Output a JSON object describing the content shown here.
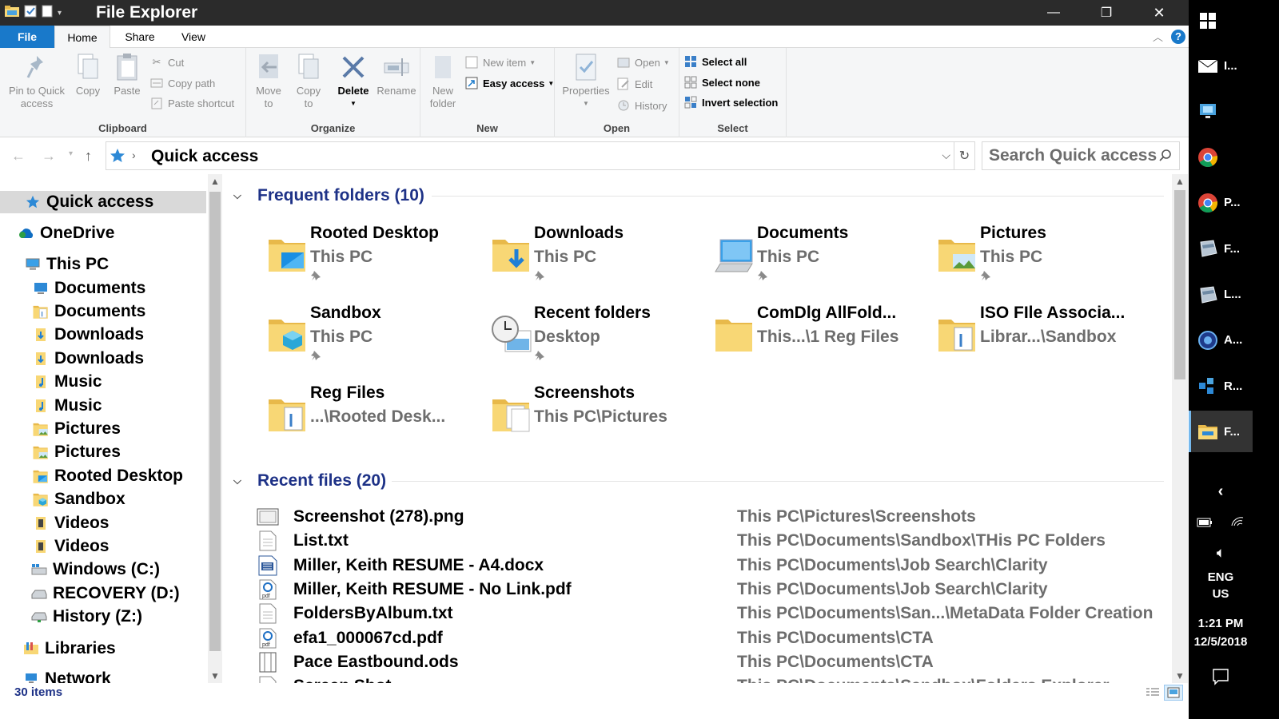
{
  "window": {
    "title": "File Explorer",
    "minimize_glyph": "—",
    "restore_glyph": "❐",
    "close_glyph": "✕"
  },
  "ribbon_tabs": [
    {
      "label": "File"
    },
    {
      "label": "Home"
    },
    {
      "label": "Share"
    },
    {
      "label": "View"
    }
  ],
  "ribbon": {
    "clipboard": {
      "label": "Clipboard",
      "pin_label_1": "Pin to Quick",
      "pin_label_2": "access",
      "copy_label": "Copy",
      "paste_label": "Paste",
      "cut_label": "Cut",
      "copy_path_label": "Copy path",
      "paste_shortcut_label": "Paste shortcut"
    },
    "organize": {
      "label": "Organize",
      "move_to_1": "Move",
      "move_to_2": "to",
      "copy_to_1": "Copy",
      "copy_to_2": "to",
      "delete_label": "Delete",
      "rename_label": "Rename"
    },
    "new": {
      "label": "New",
      "new_folder_1": "New",
      "new_folder_2": "folder",
      "new_item_label": "New item",
      "easy_access_label": "Easy access"
    },
    "open": {
      "label": "Open",
      "properties_label": "Properties",
      "open_label": "Open",
      "edit_label": "Edit",
      "history_label": "History"
    },
    "select": {
      "label": "Select",
      "select_all_label": "Select all",
      "select_none_label": "Select none",
      "invert_label": "Invert selection"
    }
  },
  "address": {
    "location": "Quick access",
    "separator": "›",
    "search_placeholder": "Search Quick access"
  },
  "nav": {
    "items": [
      {
        "label": "Quick access",
        "icon": "star-icon"
      },
      {
        "label": "OneDrive",
        "icon": "cloud-icon"
      },
      {
        "label": "This PC",
        "icon": "computer-icon"
      },
      {
        "label": "Documents",
        "icon": "desktop-icon"
      },
      {
        "label": "Documents",
        "icon": "document-folder-icon"
      },
      {
        "label": "Downloads",
        "icon": "download-folder-icon"
      },
      {
        "label": "Downloads",
        "icon": "download-folder-icon"
      },
      {
        "label": "Music",
        "icon": "music-folder-icon"
      },
      {
        "label": "Music",
        "icon": "music-folder-icon"
      },
      {
        "label": "Pictures",
        "icon": "pictures-folder-icon"
      },
      {
        "label": "Pictures",
        "icon": "pictures-folder-icon"
      },
      {
        "label": "Rooted Desktop",
        "icon": "desktop-folder-icon"
      },
      {
        "label": "Sandbox",
        "icon": "sandbox-folder-icon"
      },
      {
        "label": "Videos",
        "icon": "videos-folder-icon"
      },
      {
        "label": "Videos",
        "icon": "videos-folder-icon"
      },
      {
        "label": "Windows (C:)",
        "icon": "windows-drive-icon"
      },
      {
        "label": "RECOVERY (D:)",
        "icon": "drive-icon"
      },
      {
        "label": "History (Z:)",
        "icon": "network-drive-icon"
      },
      {
        "label": "Libraries",
        "icon": "libraries-icon"
      },
      {
        "label": "Network",
        "icon": "network-icon"
      }
    ]
  },
  "frequent": {
    "header": "Frequent folders (10)",
    "tiles": [
      {
        "name": "Rooted Desktop",
        "path": "This PC",
        "pinned": true,
        "icon": "desktop-folder-icon"
      },
      {
        "name": "Downloads",
        "path": "This PC",
        "pinned": true,
        "icon": "downloads-folder-icon"
      },
      {
        "name": "Documents",
        "path": "This PC",
        "pinned": true,
        "icon": "computer-monitor-icon"
      },
      {
        "name": "Pictures",
        "path": "This PC",
        "pinned": true,
        "icon": "pictures-folder-icon"
      },
      {
        "name": "Sandbox",
        "path": "This PC",
        "pinned": true,
        "icon": "sandbox-folder-icon"
      },
      {
        "name": "Recent folders",
        "path": "Desktop",
        "pinned": true,
        "icon": "recent-folders-icon"
      },
      {
        "name": "ComDlg AllFold...",
        "path": "This...\\1 Reg Files",
        "pinned": false,
        "icon": "folder-icon"
      },
      {
        "name": "ISO FIle Associa...",
        "path": "Librar...\\Sandbox",
        "pinned": false,
        "icon": "document-folder-icon"
      },
      {
        "name": "Reg Files",
        "path": "...\\Rooted Desk...",
        "pinned": false,
        "icon": "document-folder-icon"
      },
      {
        "name": "Screenshots",
        "path": "This PC\\Pictures",
        "pinned": false,
        "icon": "documents-folder-icon"
      }
    ]
  },
  "recent": {
    "header": "Recent files (20)",
    "files": [
      {
        "name": "Screenshot (278).png",
        "path": "This PC\\Pictures\\Screenshots",
        "icon": "image-file-icon"
      },
      {
        "name": "List.txt",
        "path": "This PC\\Documents\\Sandbox\\THis PC Folders",
        "icon": "text-file-icon"
      },
      {
        "name": "Miller, Keith RESUME - A4.docx",
        "path": "This PC\\Documents\\Job Search\\Clarity",
        "icon": "word-file-icon"
      },
      {
        "name": "Miller, Keith RESUME - No Link.pdf",
        "path": "This PC\\Documents\\Job Search\\Clarity",
        "icon": "pdf-file-icon"
      },
      {
        "name": "FoldersByAlbum.txt",
        "path": "This PC\\Documents\\San...\\MetaData Folder Creation",
        "icon": "text-file-icon"
      },
      {
        "name": "efa1_000067cd.pdf",
        "path": "This PC\\Documents\\CTA",
        "icon": "pdf-file-icon"
      },
      {
        "name": "Pace Eastbound.ods",
        "path": "This PC\\Documents\\CTA",
        "icon": "spreadsheet-file-icon"
      },
      {
        "name": "Screen Shot...",
        "path": "This PC\\Documents\\Sandbox\\Folders Explorer",
        "icon": "text-file-icon"
      }
    ]
  },
  "status": {
    "count": "30 items"
  },
  "taskbar": {
    "apps": [
      {
        "label": "I...",
        "icon": "mail-icon"
      },
      {
        "label": "",
        "icon": "remote-desktop-icon"
      },
      {
        "label": "",
        "icon": "chrome-icon"
      },
      {
        "label": "P...",
        "icon": "chrome-icon"
      },
      {
        "label": "F...",
        "icon": "explorer-window-icon"
      },
      {
        "label": "L...",
        "icon": "explorer-window-icon"
      },
      {
        "label": "A...",
        "icon": "app-circle-icon"
      },
      {
        "label": "R...",
        "icon": "regedit-icon"
      },
      {
        "label": "F...",
        "icon": "file-explorer-icon"
      }
    ],
    "language_1": "ENG",
    "language_2": "US",
    "time": "1:21 PM",
    "date": "12/5/2018"
  },
  "colors": {
    "accent": "#1979ca",
    "section_header": "#1e3287",
    "folder_yellow": "#f8d775",
    "taskbar_bg": "#000000"
  }
}
